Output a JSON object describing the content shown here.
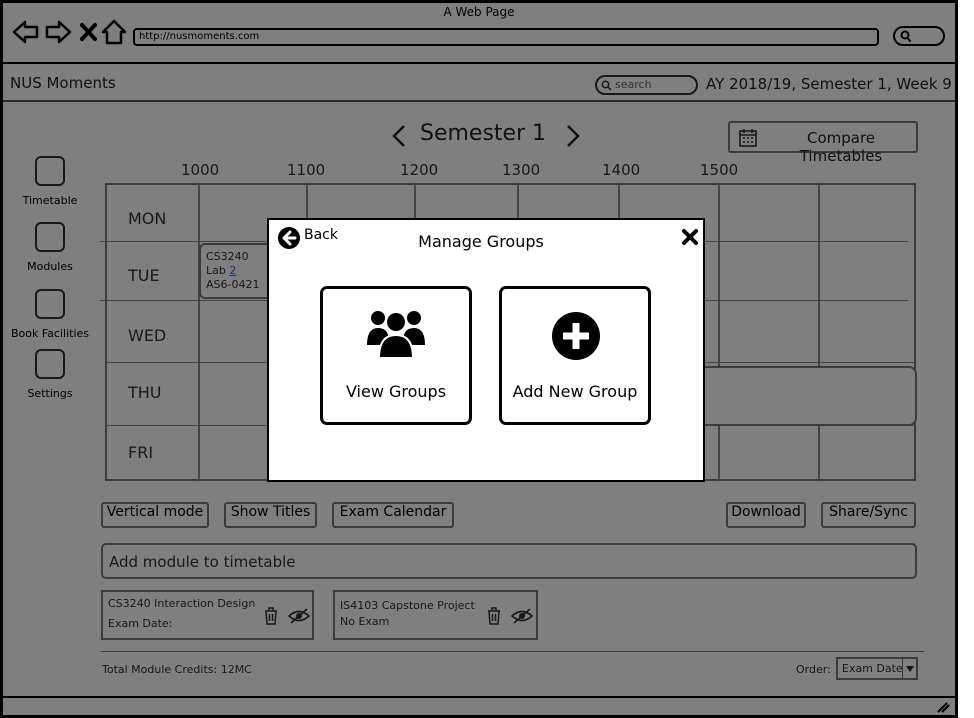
{
  "browser": {
    "window_title": "A Web Page",
    "url": "http://nusmoments.com"
  },
  "app": {
    "name": "NUS Moments",
    "search_placeholder": "search",
    "term": "AY 2018/19, Semester 1, Week 9"
  },
  "timetable": {
    "semester_label": "Semester 1",
    "compare_label": "Compare Timetables",
    "hours": [
      "1000",
      "1100",
      "1200",
      "1300",
      "1400",
      "1500"
    ],
    "days": [
      "MON",
      "TUE",
      "WED",
      "THU",
      "FRI"
    ],
    "lesson": {
      "module": "CS3240",
      "type": "Lab",
      "group": "2",
      "venue": "AS6-0421"
    }
  },
  "sidebar": {
    "items": [
      {
        "label": "Timetable"
      },
      {
        "label": "Modules"
      },
      {
        "label": "Book Facilities"
      },
      {
        "label": "Settings"
      }
    ]
  },
  "toolbar": {
    "vertical_mode": "Vertical mode",
    "show_titles": "Show Titles",
    "exam_calendar": "Exam Calendar",
    "download": "Download",
    "share_sync": "Share/Sync"
  },
  "add_module": {
    "placeholder": "Add module to timetable"
  },
  "modules": [
    {
      "title": "CS3240 Interaction Design",
      "exam": "Exam Date:"
    },
    {
      "title": "IS4103 Capstone Project",
      "exam": "No Exam"
    }
  ],
  "footer": {
    "credits": "Total Module Credits: 12MC",
    "order_label": "Order:",
    "order_value": "Exam Date"
  },
  "modal": {
    "back_label": "Back",
    "title": "Manage Groups",
    "view_groups": "View Groups",
    "add_new_group": "Add New Group"
  },
  "colors": {
    "overlay": "#808080",
    "modal_border": "#000000"
  }
}
